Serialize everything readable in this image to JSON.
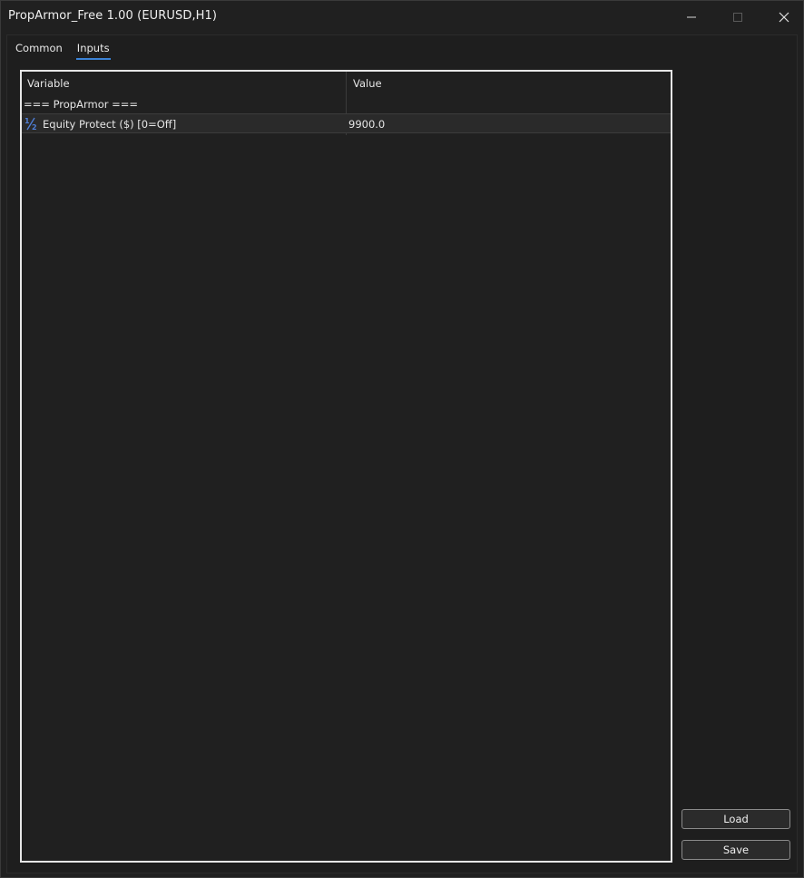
{
  "window": {
    "title": "PropArmor_Free 1.00 (EURUSD,H1)"
  },
  "tabs": [
    {
      "label": "Common",
      "active": false
    },
    {
      "label": "Inputs",
      "active": true
    }
  ],
  "table": {
    "columns": {
      "variable": "Variable",
      "value": "Value"
    },
    "rows": [
      {
        "type": "group",
        "variable": "=== PropArmor ===",
        "value": ""
      },
      {
        "type": "double",
        "icon": "fraction-half-icon",
        "variable": "Equity Protect ($) [0=Off]",
        "value": "9900.0"
      }
    ]
  },
  "buttons": {
    "load": "Load",
    "save": "Save"
  },
  "colors": {
    "accent": "#3b82d6",
    "icon": "#4f7fd9"
  }
}
